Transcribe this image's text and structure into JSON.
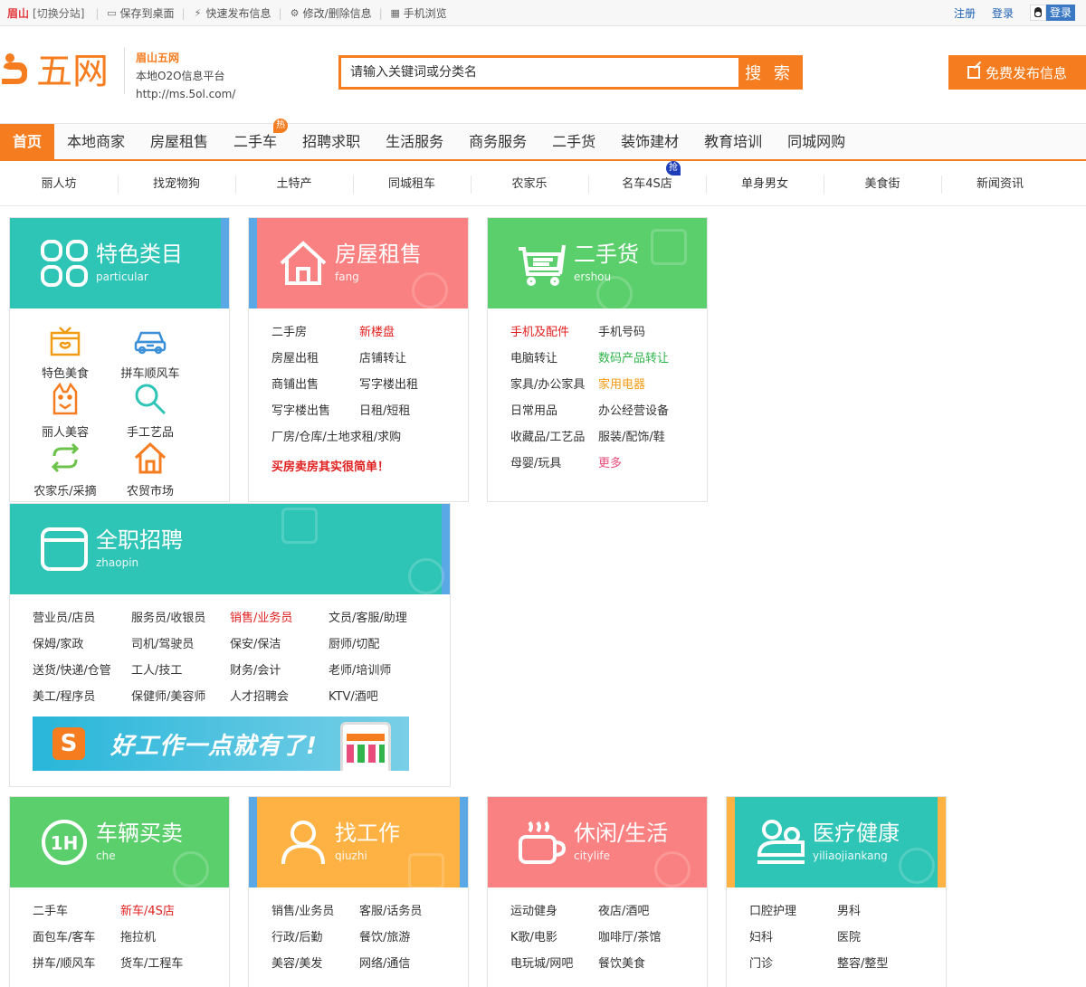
{
  "topbar": {
    "city": "眉山",
    "switch": "[切换分站]",
    "links": [
      {
        "icon": "monitor-icon",
        "label": "保存到桌面"
      },
      {
        "icon": "lightning-icon",
        "label": "快速发布信息"
      },
      {
        "icon": "gear-icon",
        "label": "修改/删除信息"
      },
      {
        "icon": "qrcode-icon",
        "label": "手机浏览"
      }
    ],
    "register": "注册",
    "login": "登录",
    "qq_login": "登录"
  },
  "header": {
    "logo_text": "五网",
    "site_name": "眉山五网",
    "slogan": "本地O2O信息平台",
    "url": "http://ms.5ol.com/",
    "search_placeholder": "请输入关键词或分类名",
    "search_button": "搜 索",
    "post_button": "免费发布信息"
  },
  "mainnav": {
    "items": [
      "首页",
      "本地商家",
      "房屋租售",
      "二手车",
      "招聘求职",
      "生活服务",
      "商务服务",
      "二手货",
      "装饰建材",
      "教育培训",
      "同城网购"
    ],
    "hot_badge": "热"
  },
  "subnav": {
    "items": [
      "丽人坊",
      "找宠物狗",
      "土特产",
      "同城租车",
      "农家乐",
      "名车4S店",
      "单身男女",
      "美食街",
      "新闻资讯"
    ],
    "grab_badge": "抢"
  },
  "cards": {
    "tese": {
      "title": "特色类目",
      "sub": "particular",
      "items": [
        "特色美食",
        "拼车顺风车",
        "丽人美容",
        "手工艺品",
        "农家乐/采摘",
        "农贸市场"
      ]
    },
    "fang": {
      "title": "房屋租售",
      "sub": "fang",
      "rows": [
        [
          "二手房",
          "新楼盘"
        ],
        [
          "房屋出租",
          "店铺转让"
        ],
        [
          "商铺出售",
          "写字楼出租"
        ],
        [
          "写字楼出售",
          "日租/短租"
        ],
        [
          "厂房/仓库/土地求租/求购"
        ]
      ],
      "slogan": "买房卖房其实很简单！"
    },
    "ershou": {
      "title": "二手货",
      "sub": "ershou",
      "rows": [
        [
          "手机及配件",
          "手机号码"
        ],
        [
          "电脑转让",
          "数码产品转让"
        ],
        [
          "家具/办公家具",
          "家用电器"
        ],
        [
          "日常用品",
          "办公经营设备"
        ],
        [
          "收藏品/工艺品",
          "服装/配饰/鞋"
        ],
        [
          "母婴/玩具",
          "更多"
        ]
      ]
    },
    "zhaopin": {
      "title": "全职招聘",
      "sub": "zhaopin",
      "rows": [
        [
          "营业员/店员",
          "服务员/收银员",
          "销售/业务员",
          "文员/客服/助理"
        ],
        [
          "保姆/家政",
          "司机/驾驶员",
          "保安/保洁",
          "厨师/切配"
        ],
        [
          "送货/快递/仓管",
          "工人/技工",
          "财务/会计",
          "老师/培训师"
        ],
        [
          "美工/程序员",
          "保健师/美容师",
          "人才招聘会",
          "KTV/酒吧"
        ]
      ],
      "banner": "好工作一点就有了!"
    },
    "che": {
      "title": "车辆买卖",
      "sub": "che",
      "rows": [
        [
          "二手车",
          "新车/4S店"
        ],
        [
          "面包车/客车",
          "拖拉机"
        ],
        [
          "拼车/顺风车",
          "货车/工程车"
        ]
      ]
    },
    "qiuzhi": {
      "title": "找工作",
      "sub": "qiuzhi",
      "rows": [
        [
          "销售/业务员",
          "客服/话务员"
        ],
        [
          "行政/后勤",
          "餐饮/旅游"
        ],
        [
          "美容/美发",
          "网络/通信"
        ]
      ]
    },
    "citylife": {
      "title": "休闲/生活",
      "sub": "citylife",
      "rows": [
        [
          "运动健身",
          "夜店/酒吧"
        ],
        [
          "K歌/电影",
          "咖啡厅/茶馆"
        ],
        [
          "电玩城/网吧",
          "餐饮美食"
        ]
      ]
    },
    "yiliao": {
      "title": "医疗健康",
      "sub": "yiliaojiankang",
      "rows": [
        [
          "口腔护理",
          "男科"
        ],
        [
          "妇科",
          "医院"
        ],
        [
          "门诊",
          "整容/整型"
        ]
      ]
    }
  },
  "colors": {
    "brand": "#f57c1f",
    "teal": "#2ec4b6",
    "salmon": "#fa8181",
    "green": "#5ccf6d",
    "amber": "#ffb244",
    "stripe_blue": "#5aa9e6"
  }
}
